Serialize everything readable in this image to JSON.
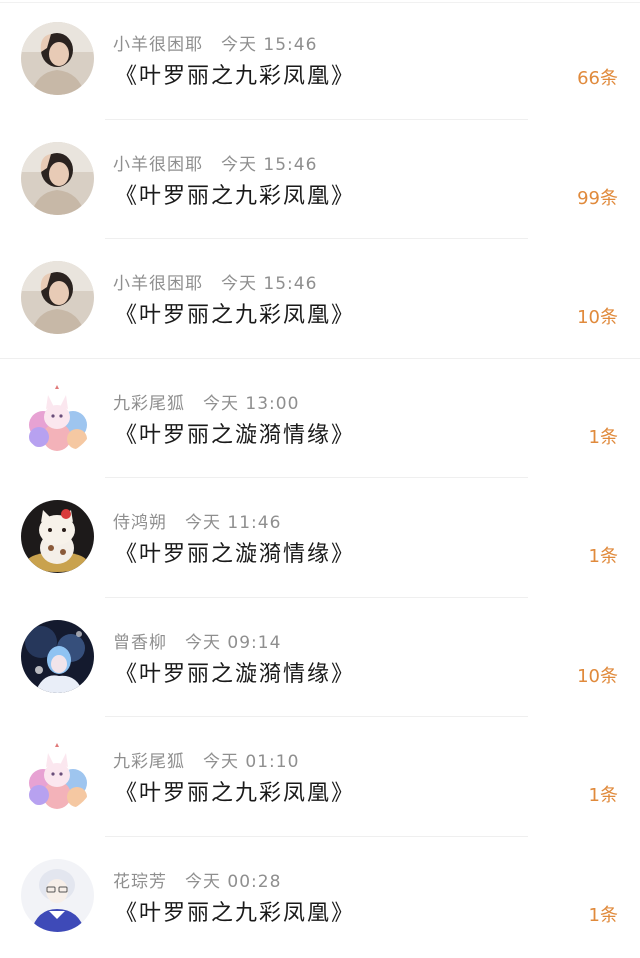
{
  "items": [
    {
      "user": "小羊很困耶",
      "time": "今天 15:46",
      "title": "《叶罗丽之九彩凤凰》",
      "count": "66条",
      "avatar": "girl-portrait-avatar"
    },
    {
      "user": "小羊很困耶",
      "time": "今天 15:46",
      "title": "《叶罗丽之九彩凤凰》",
      "count": "99条",
      "avatar": "girl-portrait-avatar"
    },
    {
      "user": "小羊很困耶",
      "time": "今天 15:46",
      "title": "《叶罗丽之九彩凤凰》",
      "count": "10条",
      "avatar": "girl-portrait-avatar"
    },
    {
      "user": "九彩尾狐",
      "time": "今天 13:00",
      "title": "《叶罗丽之漩漪情缘》",
      "count": "1条",
      "avatar": "nine-tail-fox-avatar"
    },
    {
      "user": "侍鸿朔",
      "time": "今天 11:46",
      "title": "《叶罗丽之漩漪情缘》",
      "count": "1条",
      "avatar": "lucky-cat-avatar"
    },
    {
      "user": "曾香柳",
      "time": "今天 09:14",
      "title": "《叶罗丽之漩漪情缘》",
      "count": "10条",
      "avatar": "anime-fairy-avatar"
    },
    {
      "user": "九彩尾狐",
      "time": "今天 01:10",
      "title": "《叶罗丽之九彩凤凰》",
      "count": "1条",
      "avatar": "nine-tail-fox-avatar"
    },
    {
      "user": "花琮芳",
      "time": "今天 00:28",
      "title": "《叶罗丽之九彩凤凰》",
      "count": "1条",
      "avatar": "anime-boy-avatar"
    }
  ],
  "colors": {
    "count": "#e08a3c",
    "meta": "#8f8f8f",
    "title": "#1a1a1a"
  }
}
